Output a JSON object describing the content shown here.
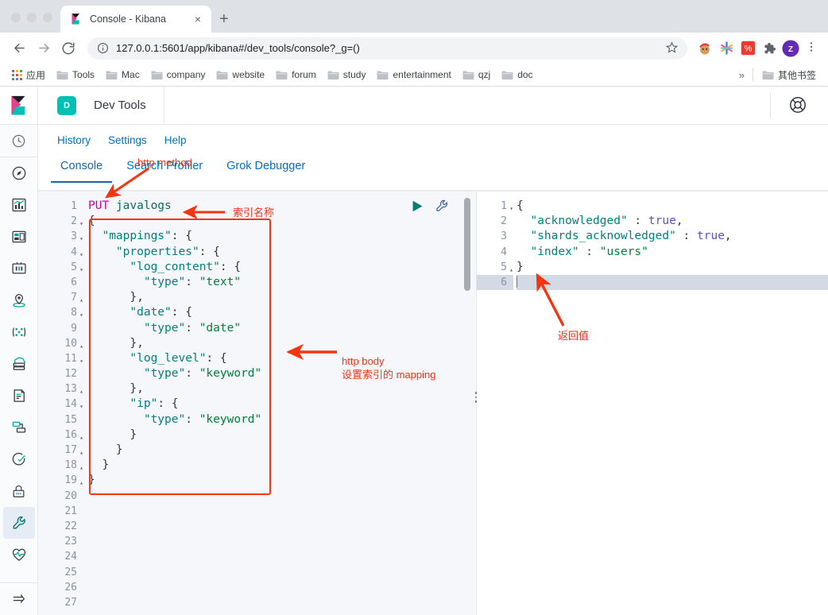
{
  "browser": {
    "tab": {
      "title": "Console - Kibana",
      "favicon": "kibana-logo-icon",
      "close_label": "×"
    },
    "new_tab_label": "+",
    "nav": {
      "back": "←",
      "forward": "→",
      "reload": "↻"
    },
    "omnibox": {
      "url": "127.0.0.1:5601/app/kibana#/dev_tools/console?_g=()",
      "info_icon": "site-info-icon",
      "star_icon": "bookmark-star-icon"
    },
    "extensions": [
      {
        "name": "santa-avatar-extension-icon",
        "color": "#e8a33d"
      },
      {
        "name": "colorful-asterisk-extension-icon",
        "color": "#4a4ae0"
      },
      {
        "name": "red-square-extension-icon",
        "color": "#ee3b2f"
      },
      {
        "name": "puzzle-piece-extensions-icon",
        "color": "#5f6368"
      }
    ],
    "profile": {
      "initial": "Z",
      "color": "#6429b5"
    },
    "menu_icon": "kebab-menu-icon",
    "bookmarks": {
      "apps_label": "应用",
      "items": [
        "Tools",
        "Mac",
        "company",
        "website",
        "forum",
        "study",
        "entertainment",
        "qzj",
        "doc"
      ],
      "overflow_label": "»",
      "other_label": "其他书签"
    }
  },
  "kibana": {
    "app_badge": "D",
    "app_title": "Dev Tools",
    "help_icon": "help-lifebuoy-icon",
    "nav_links": [
      "History",
      "Settings",
      "Help"
    ],
    "tabs": [
      {
        "label": "Console",
        "active": true
      },
      {
        "label": "Search Profiler",
        "active": false
      },
      {
        "label": "Grok Debugger",
        "active": false
      }
    ],
    "sidebar": [
      {
        "name": "recently-viewed-icon",
        "active": false
      },
      {
        "name": "discover-compass-icon",
        "active": false
      },
      {
        "name": "visualize-chart-icon",
        "active": false
      },
      {
        "name": "dashboard-icon",
        "active": false
      },
      {
        "name": "canvas-icon",
        "active": false
      },
      {
        "name": "maps-icon",
        "active": false
      },
      {
        "name": "machine-learning-icon",
        "active": false
      },
      {
        "name": "infrastructure-icon",
        "active": false
      },
      {
        "name": "logs-icon",
        "active": false
      },
      {
        "name": "apm-icon",
        "active": false
      },
      {
        "name": "uptime-icon",
        "active": false
      },
      {
        "name": "security-lock-icon",
        "active": false
      },
      {
        "name": "dev-tools-wrench-icon",
        "active": true
      },
      {
        "name": "monitoring-heartbeat-icon",
        "active": false
      },
      {
        "name": "collapse-sidebar-arrow-icon",
        "active": false
      }
    ],
    "console": {
      "run_icon": "play-run-request-icon",
      "wrench_icon": "request-options-wrench-icon",
      "request": {
        "line_count": 27,
        "lines": [
          {
            "n": 1,
            "fold": "",
            "tokens": [
              {
                "t": "PUT ",
                "c": "k-method"
              },
              {
                "t": "javalogs",
                "c": "k-url"
              }
            ]
          },
          {
            "n": 2,
            "fold": "▾",
            "tokens": [
              {
                "t": "{",
                "c": "k-punct"
              }
            ]
          },
          {
            "n": 3,
            "fold": "▾",
            "tokens": [
              {
                "t": "  ",
                "c": "k-punct"
              },
              {
                "t": "\"mappings\"",
                "c": "k-key"
              },
              {
                "t": ": {",
                "c": "k-punct"
              }
            ]
          },
          {
            "n": 4,
            "fold": "▾",
            "tokens": [
              {
                "t": "    ",
                "c": "k-punct"
              },
              {
                "t": "\"properties\"",
                "c": "k-key"
              },
              {
                "t": ": {",
                "c": "k-punct"
              }
            ]
          },
          {
            "n": 5,
            "fold": "▾",
            "tokens": [
              {
                "t": "      ",
                "c": "k-punct"
              },
              {
                "t": "\"log_content\"",
                "c": "k-key"
              },
              {
                "t": ": {",
                "c": "k-punct"
              }
            ]
          },
          {
            "n": 6,
            "fold": "",
            "tokens": [
              {
                "t": "        ",
                "c": "k-punct"
              },
              {
                "t": "\"type\"",
                "c": "k-key"
              },
              {
                "t": ": ",
                "c": "k-punct"
              },
              {
                "t": "\"text\"",
                "c": "k-str"
              }
            ]
          },
          {
            "n": 7,
            "fold": "▴",
            "tokens": [
              {
                "t": "      },",
                "c": "k-punct"
              }
            ]
          },
          {
            "n": 8,
            "fold": "▾",
            "tokens": [
              {
                "t": "      ",
                "c": "k-punct"
              },
              {
                "t": "\"date\"",
                "c": "k-key"
              },
              {
                "t": ": {",
                "c": "k-punct"
              }
            ]
          },
          {
            "n": 9,
            "fold": "",
            "tokens": [
              {
                "t": "        ",
                "c": "k-punct"
              },
              {
                "t": "\"type\"",
                "c": "k-key"
              },
              {
                "t": ": ",
                "c": "k-punct"
              },
              {
                "t": "\"date\"",
                "c": "k-str"
              }
            ]
          },
          {
            "n": 10,
            "fold": "▴",
            "tokens": [
              {
                "t": "      },",
                "c": "k-punct"
              }
            ]
          },
          {
            "n": 11,
            "fold": "▾",
            "tokens": [
              {
                "t": "      ",
                "c": "k-punct"
              },
              {
                "t": "\"log_level\"",
                "c": "k-key"
              },
              {
                "t": ": {",
                "c": "k-punct"
              }
            ]
          },
          {
            "n": 12,
            "fold": "",
            "tokens": [
              {
                "t": "        ",
                "c": "k-punct"
              },
              {
                "t": "\"type\"",
                "c": "k-key"
              },
              {
                "t": ": ",
                "c": "k-punct"
              },
              {
                "t": "\"keyword\"",
                "c": "k-str"
              }
            ]
          },
          {
            "n": 13,
            "fold": "▴",
            "tokens": [
              {
                "t": "      },",
                "c": "k-punct"
              }
            ]
          },
          {
            "n": 14,
            "fold": "▾",
            "tokens": [
              {
                "t": "      ",
                "c": "k-punct"
              },
              {
                "t": "\"ip\"",
                "c": "k-key"
              },
              {
                "t": ": {",
                "c": "k-punct"
              }
            ]
          },
          {
            "n": 15,
            "fold": "",
            "tokens": [
              {
                "t": "        ",
                "c": "k-punct"
              },
              {
                "t": "\"type\"",
                "c": "k-key"
              },
              {
                "t": ": ",
                "c": "k-punct"
              },
              {
                "t": "\"keyword\"",
                "c": "k-str"
              }
            ]
          },
          {
            "n": 16,
            "fold": "▴",
            "tokens": [
              {
                "t": "      }",
                "c": "k-punct"
              }
            ]
          },
          {
            "n": 17,
            "fold": "▴",
            "tokens": [
              {
                "t": "    }",
                "c": "k-punct"
              }
            ]
          },
          {
            "n": 18,
            "fold": "▴",
            "tokens": [
              {
                "t": "  }",
                "c": "k-punct"
              }
            ]
          },
          {
            "n": 19,
            "fold": "▴",
            "tokens": [
              {
                "t": "}",
                "c": "k-punct"
              }
            ]
          },
          {
            "n": 20,
            "fold": "",
            "tokens": []
          },
          {
            "n": 21,
            "fold": "",
            "tokens": []
          },
          {
            "n": 22,
            "fold": "",
            "tokens": []
          },
          {
            "n": 23,
            "fold": "",
            "tokens": []
          },
          {
            "n": 24,
            "fold": "",
            "tokens": []
          },
          {
            "n": 25,
            "fold": "",
            "tokens": []
          },
          {
            "n": 26,
            "fold": "",
            "tokens": []
          },
          {
            "n": 27,
            "fold": "",
            "tokens": []
          }
        ]
      },
      "response": {
        "line_count": 6,
        "lines": [
          {
            "n": 1,
            "fold": "▾",
            "hl": false,
            "tokens": [
              {
                "t": "{",
                "c": "k-punct"
              }
            ]
          },
          {
            "n": 2,
            "fold": "",
            "hl": false,
            "tokens": [
              {
                "t": "  ",
                "c": "k-punct"
              },
              {
                "t": "\"acknowledged\"",
                "c": "k-key"
              },
              {
                "t": " : ",
                "c": "k-punct"
              },
              {
                "t": "true",
                "c": "k-bool"
              },
              {
                "t": ",",
                "c": "k-punct"
              }
            ]
          },
          {
            "n": 3,
            "fold": "",
            "hl": false,
            "tokens": [
              {
                "t": "  ",
                "c": "k-punct"
              },
              {
                "t": "\"shards_acknowledged\"",
                "c": "k-key"
              },
              {
                "t": " : ",
                "c": "k-punct"
              },
              {
                "t": "true",
                "c": "k-bool"
              },
              {
                "t": ",",
                "c": "k-punct"
              }
            ]
          },
          {
            "n": 4,
            "fold": "",
            "hl": false,
            "tokens": [
              {
                "t": "  ",
                "c": "k-punct"
              },
              {
                "t": "\"index\"",
                "c": "k-key"
              },
              {
                "t": " : ",
                "c": "k-punct"
              },
              {
                "t": "\"users\"",
                "c": "k-str"
              }
            ]
          },
          {
            "n": 5,
            "fold": "▴",
            "hl": false,
            "tokens": [
              {
                "t": "}",
                "c": "k-punct"
              }
            ]
          },
          {
            "n": 6,
            "fold": "",
            "hl": true,
            "tokens": []
          }
        ]
      }
    }
  },
  "annotations": {
    "color": "#ff2d16",
    "items": [
      {
        "name": "annotation-http-method",
        "text": "http method"
      },
      {
        "name": "annotation-index-name",
        "text": "索引名称"
      },
      {
        "name": "annotation-http-body",
        "text": "http body"
      },
      {
        "name": "annotation-mapping-note",
        "text": "设置索引的 mapping"
      },
      {
        "name": "annotation-return-value",
        "text": "返回值"
      }
    ]
  }
}
